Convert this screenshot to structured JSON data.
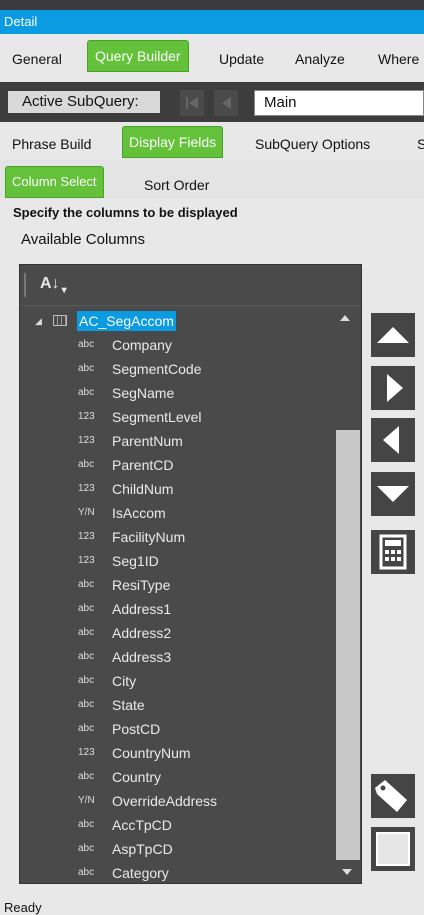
{
  "header": {
    "title": "Detail"
  },
  "main_tabs": [
    "General",
    "Query Builder",
    "Update",
    "Analyze",
    "Where"
  ],
  "subquery": {
    "label": "Active SubQuery:",
    "value": "Main"
  },
  "sub_tabs": [
    "Phrase Build",
    "Display Fields",
    "SubQuery Options",
    "S"
  ],
  "inner_tabs": [
    "Column Select",
    "Sort Order"
  ],
  "instructions": "Specify the columns to be displayed",
  "available_label": "Available Columns",
  "tree": {
    "root": "AC_SegAccom",
    "columns": [
      {
        "type": "abc",
        "name": "Company"
      },
      {
        "type": "abc",
        "name": "SegmentCode"
      },
      {
        "type": "abc",
        "name": "SegName"
      },
      {
        "type": "123",
        "name": "SegmentLevel"
      },
      {
        "type": "123",
        "name": "ParentNum"
      },
      {
        "type": "abc",
        "name": "ParentCD"
      },
      {
        "type": "123",
        "name": "ChildNum"
      },
      {
        "type": "Y/N",
        "name": "IsAccom"
      },
      {
        "type": "123",
        "name": "FacilityNum"
      },
      {
        "type": "123",
        "name": "Seg1ID"
      },
      {
        "type": "abc",
        "name": "ResiType"
      },
      {
        "type": "abc",
        "name": "Address1"
      },
      {
        "type": "abc",
        "name": "Address2"
      },
      {
        "type": "abc",
        "name": "Address3"
      },
      {
        "type": "abc",
        "name": "City"
      },
      {
        "type": "abc",
        "name": "State"
      },
      {
        "type": "abc",
        "name": "PostCD"
      },
      {
        "type": "123",
        "name": "CountryNum"
      },
      {
        "type": "abc",
        "name": "Country"
      },
      {
        "type": "Y/N",
        "name": "OverrideAddress"
      },
      {
        "type": "abc",
        "name": "AccTpCD"
      },
      {
        "type": "abc",
        "name": "AspTpCD"
      },
      {
        "type": "abc",
        "name": "Category"
      }
    ]
  },
  "side_buttons": [
    "move-up-icon",
    "move-right-icon",
    "move-left-icon",
    "move-down-icon",
    "calculator-icon",
    "tag-icon",
    "square-icon"
  ],
  "status": "Ready",
  "colors": {
    "accent": "#63c23a",
    "header": "#0a9be3",
    "panel": "#4a4a4a"
  }
}
